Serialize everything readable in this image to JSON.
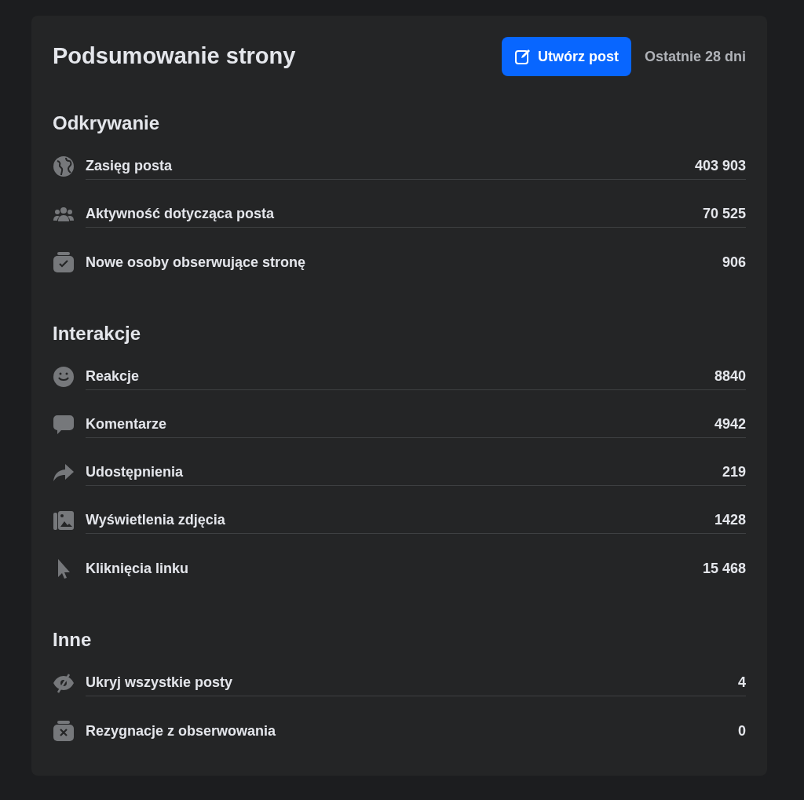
{
  "header": {
    "title": "Podsumowanie strony",
    "create_button": "Utwórz post",
    "period": "Ostatnie 28 dni"
  },
  "sections": [
    {
      "title": "Odkrywanie",
      "rows": [
        {
          "kind": "globe",
          "label": "Zasięg posta",
          "value": "403 903"
        },
        {
          "kind": "people",
          "label": "Aktywność dotycząca posta",
          "value": "70 525"
        },
        {
          "kind": "follow",
          "label": "Nowe osoby obserwujące stronę",
          "value": "906"
        }
      ]
    },
    {
      "title": "Interakcje",
      "rows": [
        {
          "kind": "smile",
          "label": "Reakcje",
          "value": "8840"
        },
        {
          "kind": "comment",
          "label": "Komentarze",
          "value": "4942"
        },
        {
          "kind": "share",
          "label": "Udostępnienia",
          "value": "219"
        },
        {
          "kind": "photos",
          "label": "Wyświetlenia zdjęcia",
          "value": "1428"
        },
        {
          "kind": "cursor",
          "label": "Kliknięcia linku",
          "value": "15 468"
        }
      ]
    },
    {
      "title": "Inne",
      "rows": [
        {
          "kind": "hidden",
          "label": "Ukryj wszystkie posty",
          "value": "4"
        },
        {
          "kind": "unfollow",
          "label": "Rezygnacje z obserwowania",
          "value": "0"
        }
      ]
    }
  ]
}
